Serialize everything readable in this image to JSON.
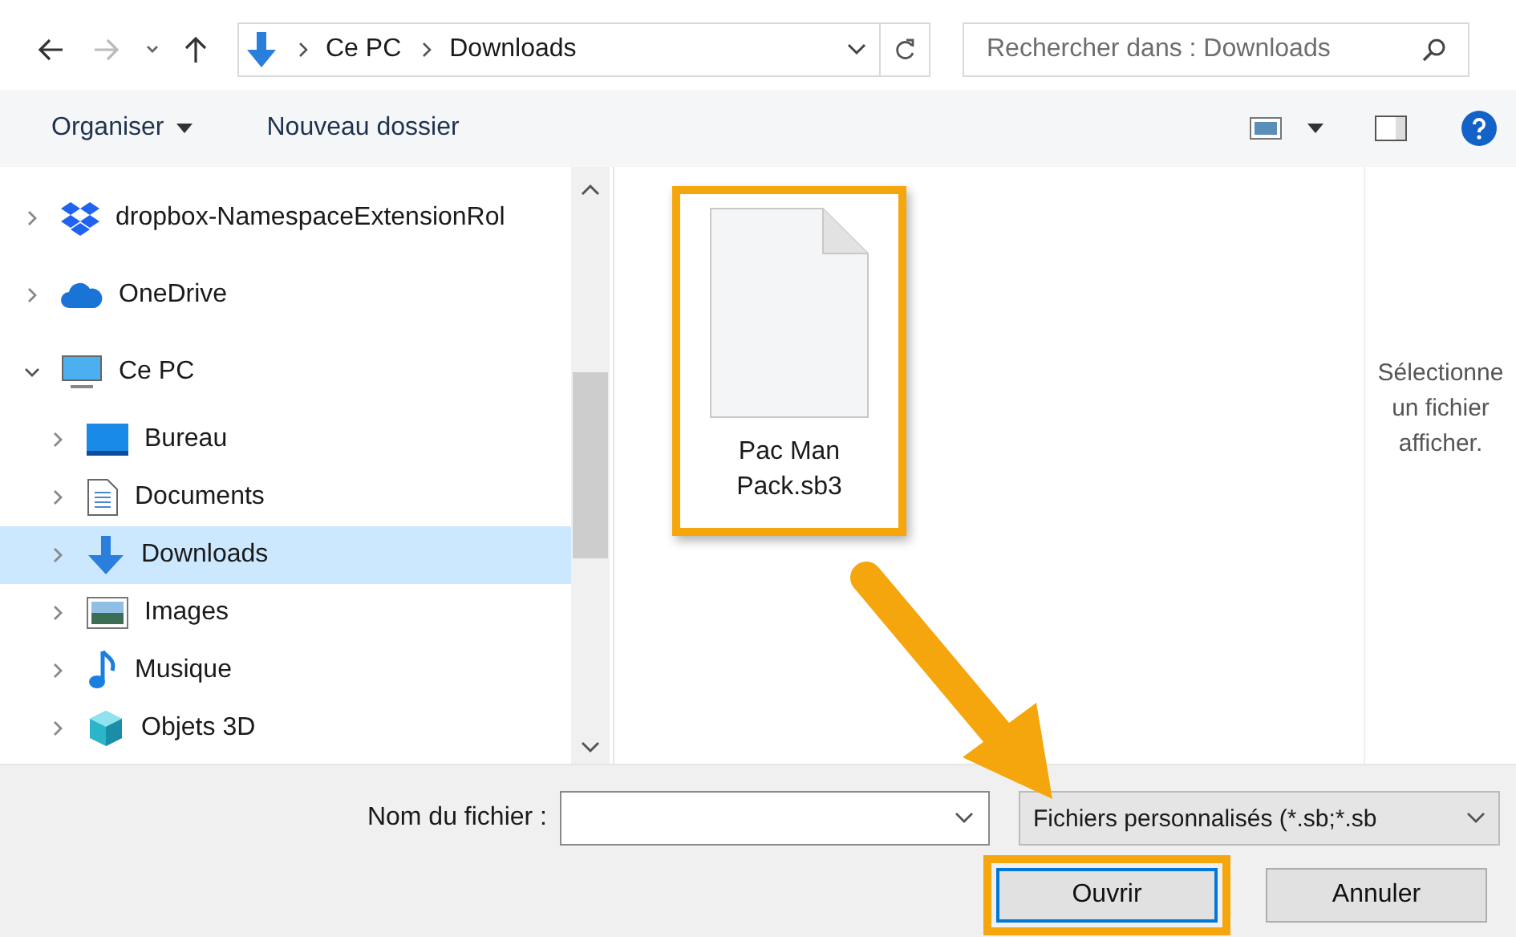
{
  "address": {
    "crumbs": [
      "Ce PC",
      "Downloads"
    ]
  },
  "search": {
    "placeholder": "Rechercher dans : Downloads"
  },
  "toolbar": {
    "organize": "Organiser",
    "new_folder": "Nouveau dossier"
  },
  "tree": [
    {
      "label": "dropbox-NamespaceExtensionRol",
      "kind": "dropbox",
      "expanded": false,
      "selected": false
    },
    {
      "label": "OneDrive",
      "kind": "cloud",
      "expanded": false,
      "selected": false
    },
    {
      "label": "Ce PC",
      "kind": "computer",
      "expanded": true,
      "selected": false,
      "children": [
        {
          "label": "Bureau",
          "kind": "desktop",
          "expanded": false,
          "selected": false
        },
        {
          "label": "Documents",
          "kind": "documents",
          "expanded": false,
          "selected": false
        },
        {
          "label": "Downloads",
          "kind": "downloads",
          "expanded": false,
          "selected": true
        },
        {
          "label": "Images",
          "kind": "images",
          "expanded": false,
          "selected": false
        },
        {
          "label": "Musique",
          "kind": "music",
          "expanded": false,
          "selected": false
        },
        {
          "label": "Objets 3D",
          "kind": "cube",
          "expanded": false,
          "selected": false
        }
      ]
    }
  ],
  "files": [
    {
      "name": "Pac Man Pack.sb3",
      "highlighted": true
    }
  ],
  "preview": [
    "Sélectionne",
    "un fichier",
    "afficher."
  ],
  "filename": {
    "label": "Nom du fichier :"
  },
  "filetype": {
    "value": "Fichiers personnalisés (*.sb;*.sb"
  },
  "buttons": [
    {
      "label": "Ouvrir",
      "default": true,
      "highlighted": true
    },
    {
      "label": "Annuler",
      "default": false,
      "highlighted": false
    }
  ]
}
